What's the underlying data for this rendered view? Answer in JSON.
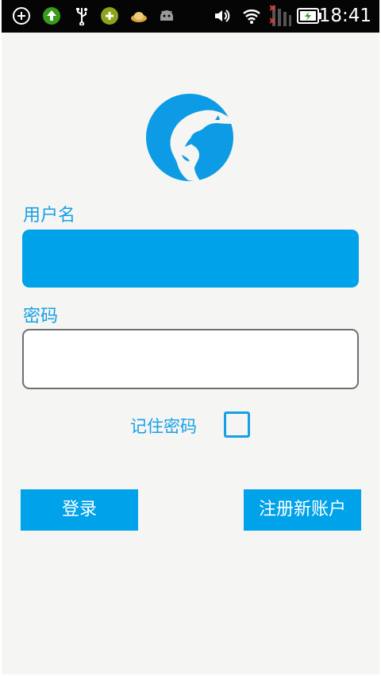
{
  "status_bar": {
    "time": "18:41",
    "left_icons": [
      "add-circle-icon",
      "upload-arrow-icon",
      "usb-icon",
      "game-icon",
      "cloud-sync-icon",
      "android-robot-icon"
    ],
    "right_icons": [
      "volume-icon",
      "wifi-icon",
      "signal-no-service-icon",
      "battery-charging-icon"
    ]
  },
  "login": {
    "username_label": "用户名",
    "username_value": "",
    "password_label": "密码",
    "password_value": "",
    "remember_label": "记住密码",
    "remember_checked": false,
    "login_button": "登录",
    "register_button": "注册新账户"
  },
  "colors": {
    "accent": "#00a2e9",
    "background": "#f5f5f3",
    "status_bar": "#050505"
  }
}
